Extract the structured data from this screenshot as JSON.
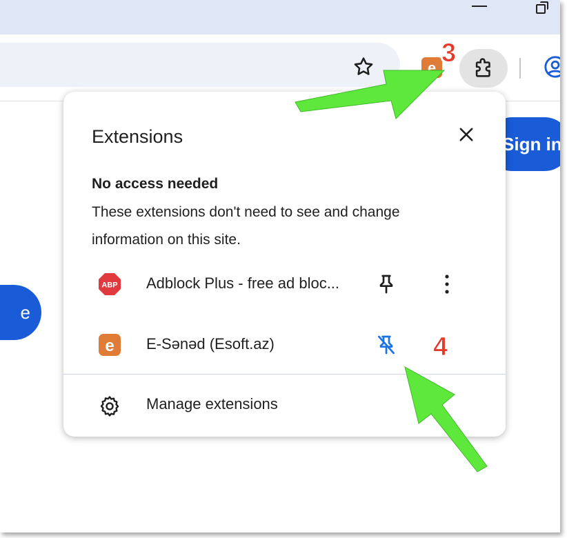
{
  "window": {
    "minimize_icon": "minimize-icon",
    "restore_icon": "restore-icon"
  },
  "toolbar": {
    "bookmark_icon": "star-icon",
    "extensions_icon": "puzzle-icon",
    "profile_icon": "profile-icon",
    "pinned_extension_letter": "e"
  },
  "page": {
    "sign_in_label": "Sign in",
    "left_button_label": "e"
  },
  "popup": {
    "title": "Extensions",
    "close_icon": "close-icon",
    "section_title": "No access needed",
    "section_description": "These extensions don't need to see and change information on this site.",
    "extensions": [
      {
        "icon_label": "ABP",
        "name": "Adblock Plus - free ad bloc...",
        "pinned": false,
        "icon_color": "#e03a3e"
      },
      {
        "icon_label": "e",
        "name": "E-Sənəd (Esoft.az)",
        "pinned": true,
        "icon_color": "#e07b37"
      }
    ],
    "manage_label": "Manage extensions"
  },
  "annotations": {
    "step_3": "3",
    "step_4": "4",
    "arrow_color": "#5ee83b",
    "badge_color": "#e53a2a"
  },
  "colors": {
    "accent": "#1a5bd7",
    "titlebar": "#dfe6f5",
    "pin_active": "#1a73e8"
  }
}
